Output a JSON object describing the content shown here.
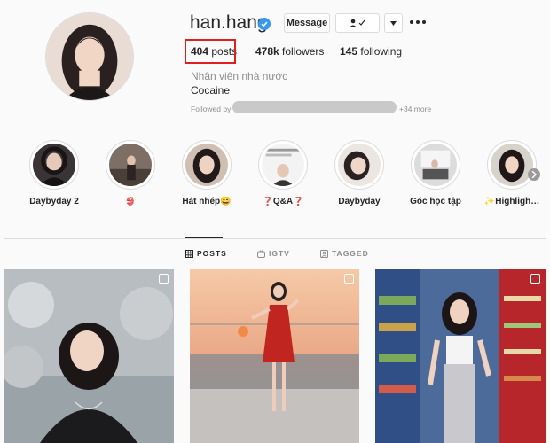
{
  "profile": {
    "username": "han.hang",
    "verified_icon": "verified-badge-icon",
    "buttons": {
      "message": "Message",
      "follow_icon": "user-check-icon",
      "dropdown_icon": "caret-down-icon",
      "more_icon": "ellipsis-icon"
    },
    "stats": {
      "posts_count": "404",
      "posts_label": "posts",
      "followers_count": "478k",
      "followers_label": "followers",
      "following_count": "145",
      "following_label": "following"
    },
    "full_name": "Nhân viên nhà nước",
    "bio": "Cocaine",
    "followed_by_prefix": "Followed by",
    "followed_by_more": "+34 more"
  },
  "highlights": [
    {
      "label": "Daybyday 2"
    },
    {
      "label": "👙"
    },
    {
      "label": "Hát nhép😄"
    },
    {
      "label": "❓Q&A❓"
    },
    {
      "label": "Daybyday"
    },
    {
      "label": "Góc học tập"
    },
    {
      "label": "✨Highligh…"
    }
  ],
  "tabs": {
    "posts": "POSTS",
    "igtv": "IGTV",
    "tagged": "TAGGED"
  },
  "colors": {
    "accent": "#3897f0",
    "highlight_box": "#e02020",
    "text": "#262626",
    "muted": "#8e8e8e",
    "border": "#dbdbdb"
  }
}
